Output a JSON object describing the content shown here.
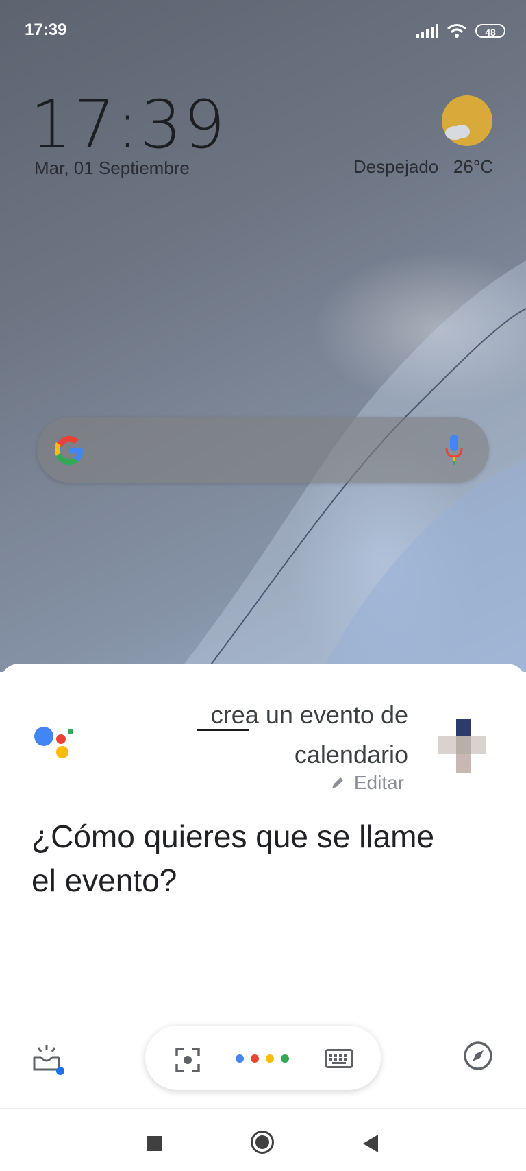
{
  "status_bar": {
    "time": "17:39",
    "battery": "48"
  },
  "home": {
    "clock": "17:39",
    "date": "Mar, 01 Septiembre",
    "weather": {
      "condition": "Despejado",
      "temperature": "26°C",
      "icon": "sun-cloud-icon"
    },
    "search": {
      "logo": "google-g-icon",
      "mic": "mic-icon"
    }
  },
  "assistant": {
    "query_line1": "crea un evento de",
    "query_line2": "calendario",
    "edit_label": "Editar",
    "prompt": "¿Cómo quieres que se llame el evento?",
    "toolbar": {
      "snapshot_icon": "snapshot-icon",
      "lens_icon": "lens-icon",
      "keyboard_icon": "keyboard-icon",
      "explore_icon": "compass-icon",
      "dot_colors": [
        "#4285F4",
        "#EA4335",
        "#FBBC05",
        "#34A853"
      ]
    }
  },
  "colors": {
    "google_blue": "#4285F4",
    "google_red": "#EA4335",
    "google_yellow": "#FBBC05",
    "google_green": "#34A853"
  }
}
